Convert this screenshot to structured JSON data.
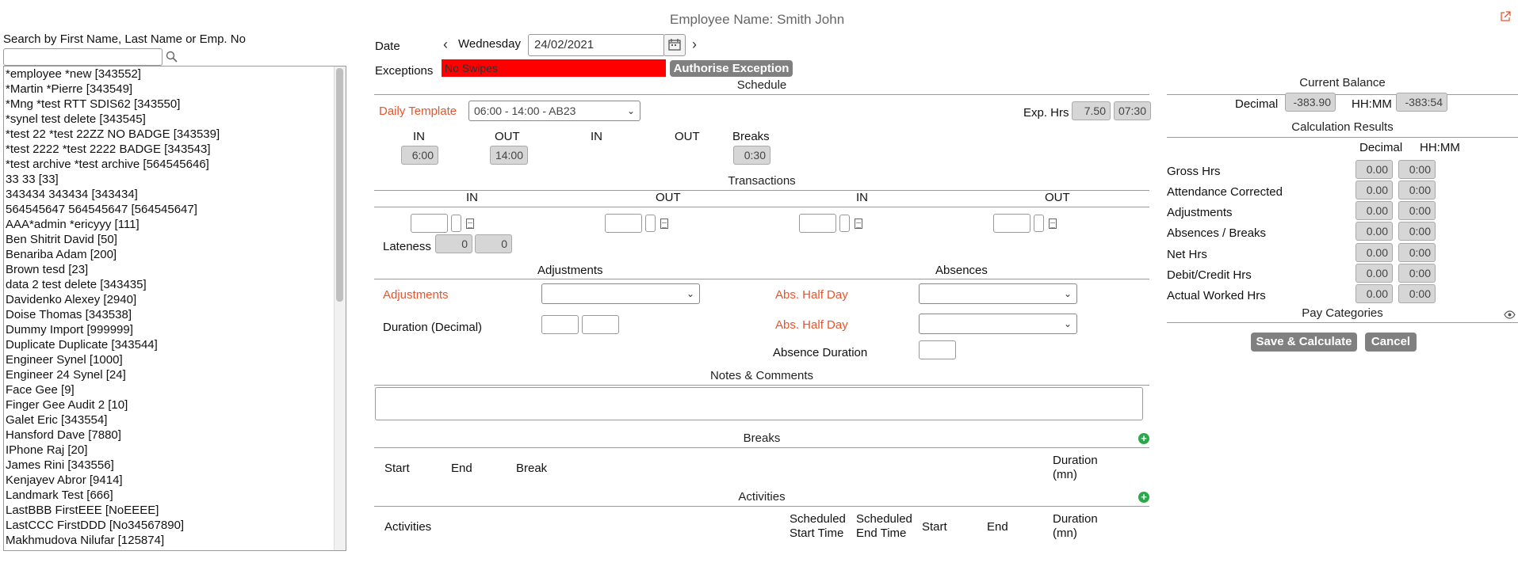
{
  "header": {
    "employee_title": "Employee Name: Smith John"
  },
  "search": {
    "label": "Search by First Name, Last Name or Emp. No",
    "value": ""
  },
  "employees": [
    "*employee *new [343552]",
    "*Martin *Pierre [343549]",
    "*Mng *test RTT SDIS62 [343550]",
    "*synel test delete [343545]",
    "*test 22 *test 22ZZ NO BADGE [343539]",
    "*test 2222 *test 2222 BADGE [343543]",
    "*test archive *test archive [564545646]",
    "33 33 [33]",
    "343434 343434 [343434]",
    "564545647 564545647 [564545647]",
    "AAA*admin *ericyyy [111]",
    "Ben Shitrit David [50]",
    "Benariba Adam [200]",
    "Brown tesd [23]",
    "data 2 test delete [343435]",
    "Davidenko Alexey [2940]",
    "Doise Thomas [343538]",
    "Dummy Import [999999]",
    "Duplicate Duplicate [343544]",
    "Engineer Synel [1000]",
    "Engineer 24 Synel [24]",
    "Face Gee [9]",
    "Finger Gee Audit 2 [10]",
    "Galet Eric [343554]",
    "Hansford Dave [7880]",
    "IPhone Raj [20]",
    "James Rini [343556]",
    "Kenjayev Abror [9414]",
    "Landmark Test [666]",
    "LastBBB FirstEEE [NoEEEE]",
    "LastCCC FirstDDD [No34567890]",
    "Makhmudova Nilufar [125874]"
  ],
  "date": {
    "label": "Date",
    "prev": "‹",
    "next": "›",
    "weekday": "Wednesday",
    "value": "24/02/2021"
  },
  "exceptions": {
    "label": "Exceptions",
    "value": "No Swipes",
    "authorise_label": "Authorise Exception"
  },
  "schedule": {
    "title": "Schedule",
    "template_label": "Daily Template",
    "template_value": "06:00 - 14:00 - AB23",
    "exp_label": "Exp. Hrs",
    "exp_decimal": "7.50",
    "exp_hhmm": "07:30",
    "col_in1": "IN",
    "col_out1": "OUT",
    "col_in2": "IN",
    "col_out2": "OUT",
    "col_breaks": "Breaks",
    "in1": "6:00",
    "out1": "14:00",
    "breaks": "0:30"
  },
  "transactions": {
    "title": "Transactions",
    "col_in1": "IN",
    "col_out1": "OUT",
    "col_in2": "IN",
    "col_out2": "OUT",
    "lateness_label": "Lateness",
    "lateness_a": "0",
    "lateness_b": "0"
  },
  "adjustments": {
    "title": "Adjustments",
    "label": "Adjustments",
    "duration_label": "Duration (Decimal)"
  },
  "absences": {
    "title": "Absences",
    "half_day_1": "Abs. Half Day",
    "half_day_2": "Abs. Half Day",
    "duration_label": "Absence Duration"
  },
  "notes": {
    "title": "Notes & Comments"
  },
  "breaks": {
    "title": "Breaks",
    "col_start": "Start",
    "col_end": "End",
    "col_break": "Break",
    "col_duration": "Duration (mn)"
  },
  "activities": {
    "title": "Activities",
    "col_activities": "Activities",
    "col_sched_start": "Scheduled Start Time",
    "col_sched_end": "Scheduled End Time",
    "col_start": "Start",
    "col_end": "End",
    "col_duration": "Duration (mn)"
  },
  "balance": {
    "title": "Current Balance",
    "decimal_label": "Decimal",
    "decimal_value": "-383.90",
    "hhmm_label": "HH:MM",
    "hhmm_value": "-383:54"
  },
  "calc": {
    "title": "Calculation Results",
    "col_decimal": "Decimal",
    "col_hhmm": "HH:MM",
    "rows": [
      {
        "label": "Gross Hrs",
        "decimal": "0.00",
        "hhmm": "0:00"
      },
      {
        "label": "Attendance Corrected",
        "decimal": "0.00",
        "hhmm": "0:00"
      },
      {
        "label": "Adjustments",
        "decimal": "0.00",
        "hhmm": "0:00"
      },
      {
        "label": "Absences / Breaks",
        "decimal": "0.00",
        "hhmm": "0:00"
      },
      {
        "label": "Net Hrs",
        "decimal": "0.00",
        "hhmm": "0:00"
      },
      {
        "label": "Debit/Credit Hrs",
        "decimal": "0.00",
        "hhmm": "0:00"
      },
      {
        "label": "Actual Worked Hrs",
        "decimal": "0.00",
        "hhmm": "0:00"
      }
    ]
  },
  "pay_categories": {
    "title": "Pay Categories"
  },
  "actions": {
    "save_label": "Save & Calculate",
    "cancel_label": "Cancel"
  },
  "colors": {
    "accent": "#e8542c",
    "exception": "#ff0000",
    "button": "#808080",
    "plus": "#2aa84a"
  },
  "icons": {
    "external": "external-link-icon",
    "search": "magnifier-icon",
    "calendar": "calendar-icon",
    "eye": "eye-icon",
    "add": "plus-circle-icon"
  }
}
